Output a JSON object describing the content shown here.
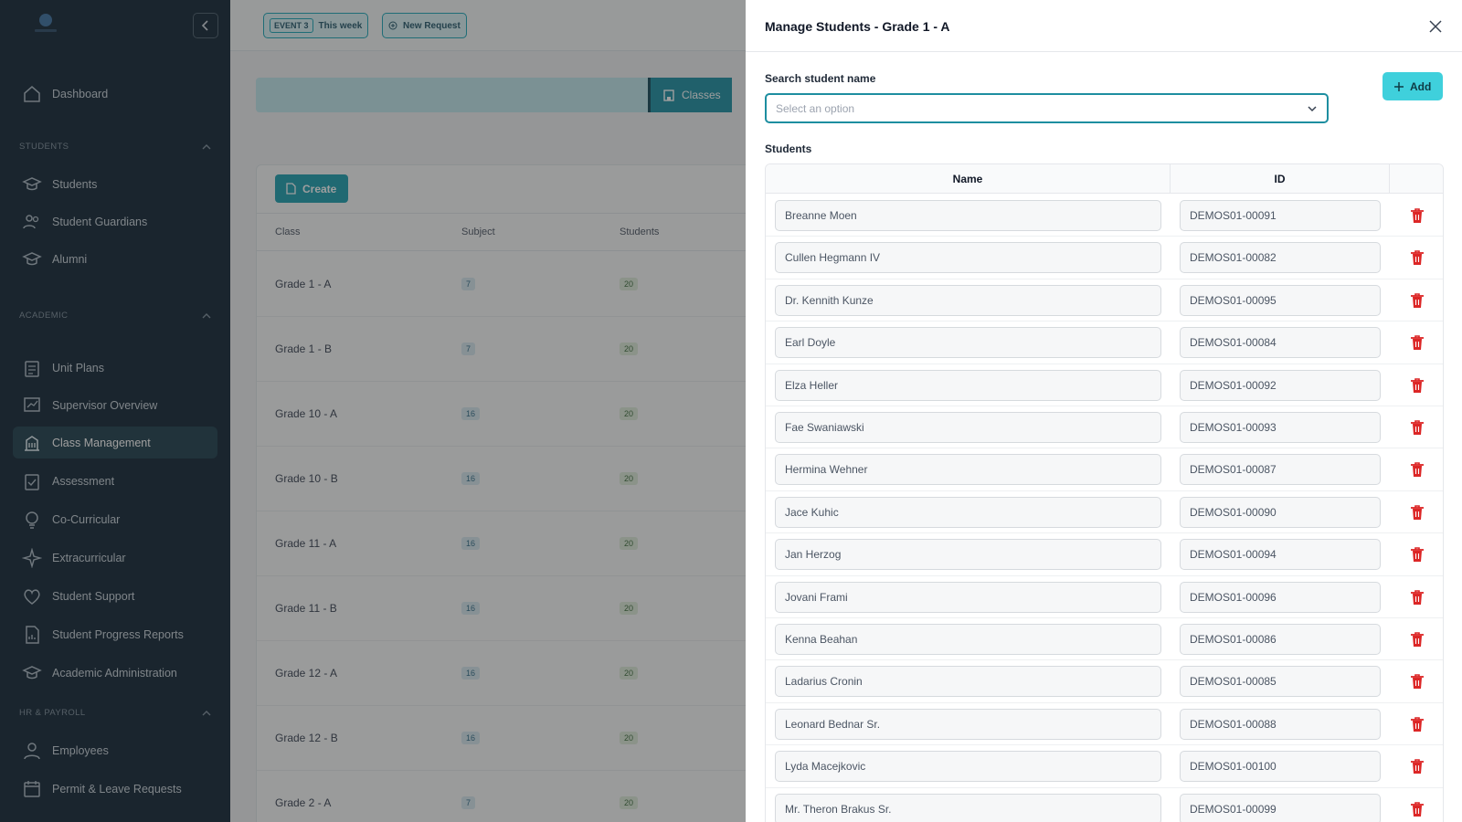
{
  "topbar": {
    "event_badge": "EVENT 3",
    "event_label": "This week",
    "new_request": "New Request"
  },
  "sidebar": {
    "items_top": [
      {
        "label": "Dashboard",
        "icon": "home-icon"
      }
    ],
    "sections": [
      {
        "title": "STUDENTS",
        "items": [
          {
            "label": "Students",
            "icon": "graduation-icon"
          },
          {
            "label": "Student Guardians",
            "icon": "users-icon"
          },
          {
            "label": "Alumni",
            "icon": "graduation-icon"
          }
        ]
      },
      {
        "title": "ACADEMIC",
        "items": [
          {
            "label": "Unit Plans",
            "icon": "clipboard-icon"
          },
          {
            "label": "Supervisor Overview",
            "icon": "chart-icon"
          },
          {
            "label": "Class Management",
            "icon": "building-icon",
            "active": true
          },
          {
            "label": "Assessment",
            "icon": "checklist-icon"
          },
          {
            "label": "Co-Curricular",
            "icon": "lightbulb-icon"
          },
          {
            "label": "Extracurricular",
            "icon": "sparkle-icon"
          },
          {
            "label": "Student Support",
            "icon": "heart-icon"
          },
          {
            "label": "Student Progress Reports",
            "icon": "report-icon"
          },
          {
            "label": "Academic Administration",
            "icon": "graduation-icon"
          }
        ]
      },
      {
        "title": "HR & PAYROLL",
        "items": [
          {
            "label": "Employees",
            "icon": "user-icon"
          },
          {
            "label": "Permit & Leave Requests",
            "icon": "calendar-icon"
          }
        ]
      }
    ]
  },
  "background": {
    "classes_button": "Classes",
    "create_button": "Create",
    "columns": [
      "Class",
      "Subject",
      "Students"
    ],
    "rows": [
      {
        "class": "Grade 1 - A",
        "subject": "7",
        "students": "20"
      },
      {
        "class": "Grade 1 - B",
        "subject": "7",
        "students": "20"
      },
      {
        "class": "Grade 10 - A",
        "subject": "16",
        "students": "20"
      },
      {
        "class": "Grade 10 - B",
        "subject": "16",
        "students": "20"
      },
      {
        "class": "Grade 11 - A",
        "subject": "16",
        "students": "20"
      },
      {
        "class": "Grade 11 - B",
        "subject": "16",
        "students": "20"
      },
      {
        "class": "Grade 12 - A",
        "subject": "16",
        "students": "20"
      },
      {
        "class": "Grade 12 - B",
        "subject": "16",
        "students": "20"
      },
      {
        "class": "Grade 2 - A",
        "subject": "7",
        "students": "20"
      }
    ]
  },
  "drawer": {
    "title": "Manage Students - Grade 1 - A",
    "search_label": "Search student name",
    "search_placeholder": "Select an option",
    "add_button": "Add",
    "students_label": "Students",
    "columns": {
      "name": "Name",
      "id": "ID"
    },
    "students": [
      {
        "name": "Breanne Moen",
        "id": "DEMOS01-00091"
      },
      {
        "name": "Cullen Hegmann IV",
        "id": "DEMOS01-00082"
      },
      {
        "name": "Dr. Kennith Kunze",
        "id": "DEMOS01-00095"
      },
      {
        "name": "Earl Doyle",
        "id": "DEMOS01-00084"
      },
      {
        "name": "Elza Heller",
        "id": "DEMOS01-00092"
      },
      {
        "name": "Fae Swaniawski",
        "id": "DEMOS01-00093"
      },
      {
        "name": "Hermina Wehner",
        "id": "DEMOS01-00087"
      },
      {
        "name": "Jace Kuhic",
        "id": "DEMOS01-00090"
      },
      {
        "name": "Jan Herzog",
        "id": "DEMOS01-00094"
      },
      {
        "name": "Jovani Frami",
        "id": "DEMOS01-00096"
      },
      {
        "name": "Kenna Beahan",
        "id": "DEMOS01-00086"
      },
      {
        "name": "Ladarius Cronin",
        "id": "DEMOS01-00085"
      },
      {
        "name": "Leonard Bednar Sr.",
        "id": "DEMOS01-00088"
      },
      {
        "name": "Lyda Macejkovic",
        "id": "DEMOS01-00100"
      },
      {
        "name": "Mr. Theron Brakus Sr.",
        "id": "DEMOS01-00099"
      }
    ]
  },
  "colors": {
    "sidebar_bg": "#0f2333",
    "accent": "#1a9eb0",
    "add_button": "#3fd0dc",
    "delete_icon": "#dc2626"
  }
}
